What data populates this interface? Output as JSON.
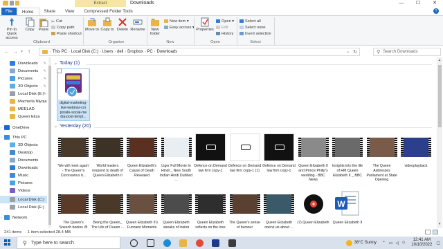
{
  "window": {
    "title": "Downloads",
    "contextual_tab": "Extract",
    "controls": [
      "—",
      "☐",
      "✕"
    ]
  },
  "tabs": [
    "File",
    "Home",
    "Share",
    "View",
    "Compressed Folder Tools"
  ],
  "ribbon": {
    "clipboard": {
      "pin": "Pin to Quick access",
      "copy": "Copy",
      "paste": "Paste",
      "cut": "Cut",
      "copy_path": "Copy path",
      "paste_shortcut": "Paste shortcut",
      "label": "Clipboard"
    },
    "organize": {
      "move_to": "Move to",
      "copy_to": "Copy to",
      "delete": "Delete",
      "rename": "Rename",
      "label": "Organize"
    },
    "new": {
      "new_folder": "New folder",
      "new_item": "New item ▾",
      "easy_access": "Easy access ▾",
      "label": "New"
    },
    "open": {
      "properties": "Properties",
      "open": "Open ▾",
      "edit": "Edit",
      "history": "History",
      "label": "Open"
    },
    "select": {
      "select_all": "Select all",
      "select_none": "Select none",
      "invert_selection": "Invert selection",
      "label": "Select"
    }
  },
  "address": {
    "crumbs": [
      "This PC",
      "Local Disk (C:)",
      "Users",
      "dell",
      "Dropbox",
      "PC",
      "Downloads"
    ],
    "search_placeholder": "Search Downloads"
  },
  "sidebar": {
    "items": [
      {
        "label": "Downloads",
        "color": "#2f7fd8",
        "pinned": true
      },
      {
        "label": "Documents",
        "color": "#8aa9c9",
        "pinned": true
      },
      {
        "label": "Pictures",
        "color": "#4aa3df",
        "pinned": true
      },
      {
        "label": "3D Objects",
        "color": "#5bb0e6",
        "pinned": true
      },
      {
        "label": "Local Disk (E:)",
        "color": "#9aa0a6",
        "pinned": true
      },
      {
        "label": "Macherla Niyoja",
        "color": "#e8b647",
        "pinned": false
      },
      {
        "label": "MEELAD",
        "color": "#e8b647",
        "pinned": false
      },
      {
        "label": "Queen Eliza",
        "color": "#e8b647",
        "pinned": false
      },
      {
        "label": "OneDrive",
        "color": "#1c6ac8",
        "pinned": false
      },
      {
        "label": "This PC",
        "color": "#3f8ad9",
        "pinned": false
      },
      {
        "label": "3D Objects",
        "color": "#5bb0e6",
        "pinned": false
      },
      {
        "label": "Desktop",
        "color": "#3f8ad9",
        "pinned": false
      },
      {
        "label": "Documents",
        "color": "#8aa9c9",
        "pinned": false
      },
      {
        "label": "Downloads",
        "color": "#2f7fd8",
        "pinned": false
      },
      {
        "label": "Music",
        "color": "#3f8ad9",
        "pinned": false
      },
      {
        "label": "Pictures",
        "color": "#4aa3df",
        "pinned": false
      },
      {
        "label": "Videos",
        "color": "#7a5fc0",
        "pinned": false
      },
      {
        "label": "Local Disk (C:)",
        "color": "#9aa0a6",
        "pinned": false,
        "selected": true
      },
      {
        "label": "Local Disk (E:)",
        "color": "#9aa0a6",
        "pinned": false
      },
      {
        "label": "Network",
        "color": "#3f8ad9",
        "pinned": false
      }
    ]
  },
  "groups": {
    "today": "Today (1)",
    "yesterday": "Yesterday (20)"
  },
  "files": {
    "today": [
      {
        "name": "digital-marketing-live-webinar-cor porate-social-me dia-post-templ...",
        "kind": "zip"
      }
    ],
    "yesterday_row1": [
      {
        "name": "'We will meet again' - The Queen's Coronavirus b...",
        "kind": "video",
        "tint": "#4a3a2c"
      },
      {
        "name": "World leaders respond to death of Queen Elizabeth II",
        "kind": "video",
        "tint": "#3d3226"
      },
      {
        "name": "Queen Elizabeth's Cause of Death Revealed",
        "kind": "video",
        "tint": "#5a3020"
      },
      {
        "name": "Liger Full Movie In Hindi _ New South Indian Hindi Dubbed ...",
        "kind": "video",
        "tint": "#e9eef3"
      },
      {
        "name": "Defence on Demand law firm copy-1",
        "kind": "image",
        "tint": "#111111"
      },
      {
        "name": "Defence on Demand law firm copy-1 (1)",
        "kind": "image",
        "tint": "#ffffff"
      },
      {
        "name": "Defence on Demand law firm copy-1",
        "kind": "image",
        "tint": "#111111"
      },
      {
        "name": "Queen Elizabeth II and Prince Philip's wedding - BBC News",
        "kind": "video",
        "tint": "#8a8a8a"
      },
      {
        "name": "Insights into the life of HM Queen Elizabeth II _ BBC",
        "kind": "video",
        "tint": "#6a6a6a"
      },
      {
        "name": "The Queen Addresses Parliament at State Opening",
        "kind": "video",
        "tint": "#7a5a48"
      },
      {
        "name": "videoplayback",
        "kind": "video",
        "tint": "#2b3f8c"
      }
    ],
    "yesterday_row2": [
      {
        "name": "The Queen's Speech begins @ The Queen's ...",
        "kind": "video",
        "tint": "#5a3a28"
      },
      {
        "name": "Being the Queen_ The Life of Queen ...",
        "kind": "video",
        "tint": "#4a3828"
      },
      {
        "name": "Queen Elizabeth II's Funniest Moments ...",
        "kind": "video",
        "tint": "#6a5040"
      },
      {
        "name": "Queen Elizabeth speaks of losing Prince Philip ...",
        "kind": "video",
        "tint": "#4c4c4c"
      },
      {
        "name": "Queen Elizabeth reflects on the loss of Prince ...",
        "kind": "video",
        "tint": "#2e2e2e"
      },
      {
        "name": "The Queen's sense of humour remembered ...",
        "kind": "video",
        "tint": "#5a4030"
      },
      {
        "name": "Queen Elizabeth opens up about ...",
        "kind": "video",
        "tint": "#3a5a6a"
      },
      {
        "name": "(7) Queen Elizabeth",
        "kind": "audio"
      },
      {
        "name": "Queen Elizabeth II",
        "kind": "word"
      }
    ]
  },
  "status": {
    "count": "241 items",
    "selected": "1 item selected  28.4 MB"
  },
  "taskbar": {
    "search_placeholder": "Type here to search",
    "weather": "36°C  Sunny",
    "time": "12:41 AM",
    "date": "10/10/2022"
  }
}
